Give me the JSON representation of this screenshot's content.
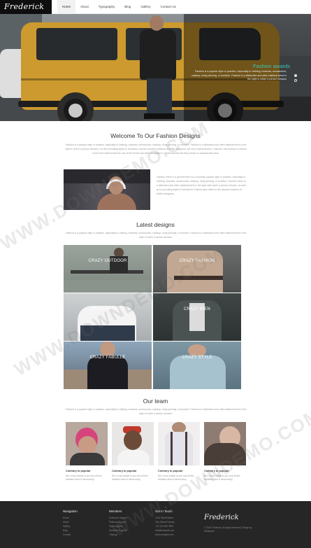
{
  "header": {
    "logo": "Frederick",
    "nav": [
      "Home",
      "About",
      "Typography",
      "Blog",
      "Gallery",
      "Contact Us"
    ]
  },
  "hero": {
    "title": "Fashion awards",
    "text": "Fashion is a popular style or practice, especially in clothing, footwear, accessories, makeup, body piercing, or furniture. Fashion is a distinctive and often habitual trend in the style in which a person dresses"
  },
  "welcome": {
    "title": "Welcome To Our Fashion Designs",
    "intro": "Fashion is a popular style or practice, especially in clothing, footwear, accessories, makeup, body piercing, or furniture. Fashion is a distinctive and often habitual trend in the style in which a person dresses. It is the prevailing styles in behaviour and the newest creations of textile designers, the more technical term, costume, has become so linked to the term fashion that the use of the former has been relegated to special senses like fancy dress or masquerade wear.",
    "feature_text": "Fashion refers to a general term for a currently popular style or practice, especially in clothing, footwear, accessories, makeup, body piercing, or furniture. Fashion refers to a distinctive and often habitual trend in the style with which a person dresses, as well as to prevailing styles in behaviour. Fashion also refers to the newest creations of textile designers."
  },
  "latest": {
    "title": "Latest designs",
    "intro": "Fashion is a popular style or practice, especially in clothing, footwear, accessories, makeup, body piercing, or furniture. Fashion is a distinctive and often habitual trend in the style in which a person dresses.",
    "tiles": [
      "CRAZY OUTDOOR",
      "CRAZY FASHION",
      "CRAZY FASHION",
      "CRAZY BIEN",
      "CRAZY FABULLE",
      "CRAZY STYLE"
    ]
  },
  "team": {
    "title": "Our team",
    "intro": "Fashion is a popular style or practice, especially in clothing, footwear, accessories, makeup, body piercing, or furniture. Fashion is a distinctive and often habitual trend in the style in which a person dresses.",
    "members": [
      {
        "name": "Contrary to popular",
        "text": "But I must explain to you how all this mistaken idea of denouncing"
      },
      {
        "name": "Contrary to popular",
        "text": "But I must explain to you how all this mistaken idea of denouncing"
      },
      {
        "name": "Contrary to popular",
        "text": "But I must explain to you how all this mistaken idea of denouncing"
      },
      {
        "name": "Contrary to popular",
        "text": "But I must explain to you how all this mistaken idea of denouncing"
      }
    ]
  },
  "footer": {
    "navigation": {
      "title": "Navigation",
      "links": [
        "Home",
        "About",
        "Gallery",
        "Blog",
        "Contact"
      ]
    },
    "members": {
      "title": "Members",
      "links": [
        "Customer Support",
        "Platinum Support",
        "Gold Support",
        "Standard Support",
        "Training"
      ]
    },
    "contact": {
      "title": "Get in Touch",
      "links": [
        "1234 Street Name",
        "City, Street Country",
        "+00 123 456 7890",
        "info@example.com",
        "www.example.com"
      ]
    },
    "logo": "Frederick",
    "copyright": "© 2016 Frederick. All rights reserved | Design by W3layouts"
  },
  "watermark": "WWW.DOWNDEMO.COM"
}
